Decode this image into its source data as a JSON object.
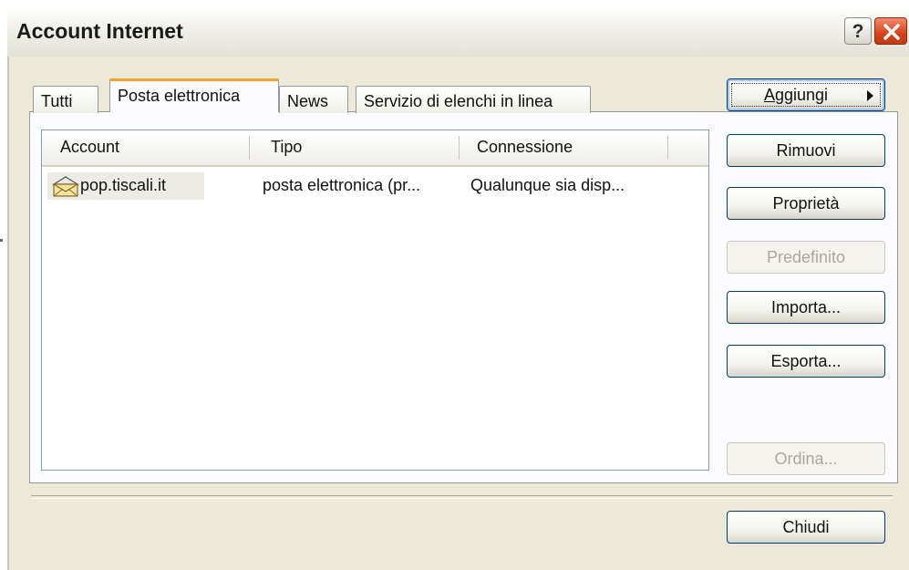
{
  "window": {
    "title": "Account Internet",
    "help_label": "?"
  },
  "tabs": [
    {
      "label": "Tutti",
      "active": false
    },
    {
      "label": "Posta elettronica",
      "active": true
    },
    {
      "label": "News",
      "active": false
    },
    {
      "label": "Servizio di elenchi in linea",
      "active": false
    }
  ],
  "list": {
    "columns": [
      "Account",
      "Tipo",
      "Connessione"
    ],
    "rows": [
      {
        "account": "pop.tiscali.it",
        "tipo": "posta elettronica (pr...",
        "connessione": "Qualunque sia disp...",
        "icon": "mail-account-icon"
      }
    ]
  },
  "buttons": {
    "aggiungi": "Aggiungi",
    "rimuovi": "Rimuovi",
    "proprieta": "Proprietà",
    "predefinito": "Predefinito",
    "importa": "Importa...",
    "esporta": "Esporta...",
    "ordina": "Ordina...",
    "chiudi": "Chiudi"
  },
  "colors": {
    "window_bg": "#ece9d8",
    "active_tab_accent": "#f2a226",
    "close_button": "#d6441d",
    "button_border": "#003c74"
  }
}
